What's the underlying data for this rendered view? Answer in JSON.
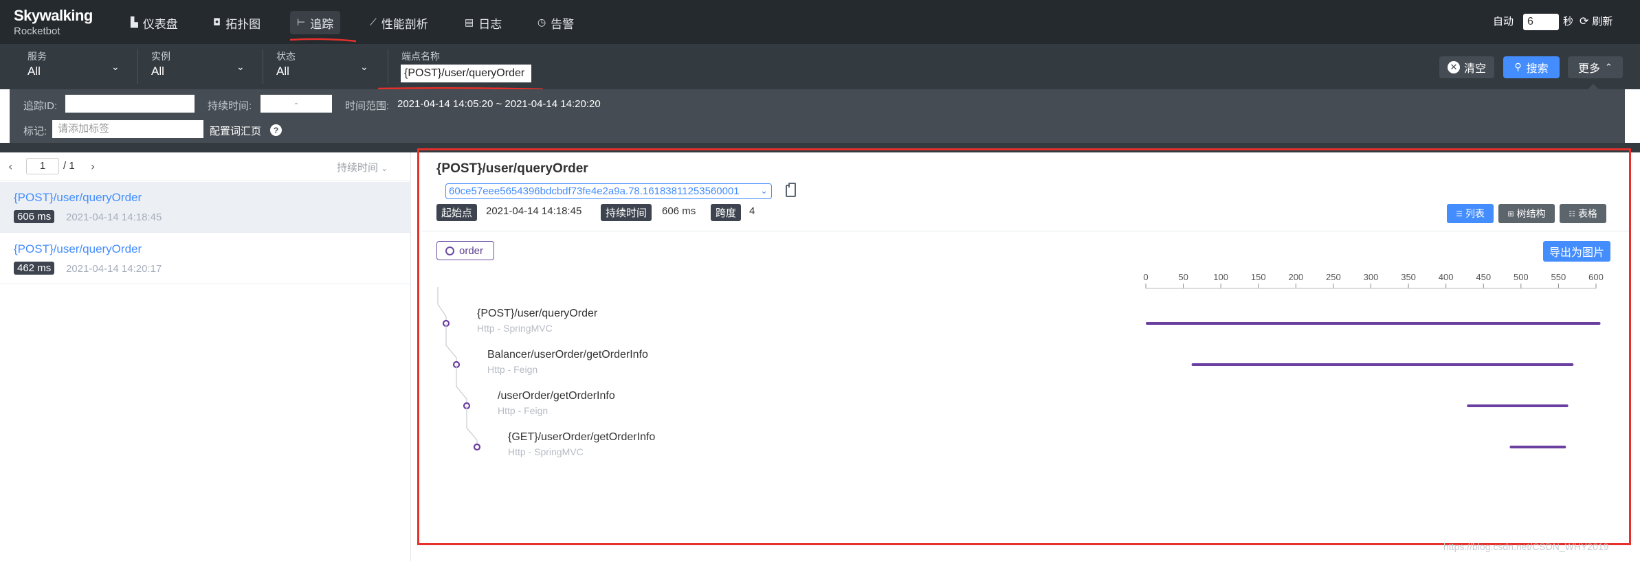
{
  "app": {
    "logo_line1": "Skywalking",
    "logo_line2": "Rocketbot"
  },
  "nav": {
    "items": [
      {
        "label": "仪表盘",
        "icon": "dashboard-icon"
      },
      {
        "label": "拓扑图",
        "icon": "topology-icon"
      },
      {
        "label": "追踪",
        "icon": "trace-icon",
        "active": true
      },
      {
        "label": "性能剖析",
        "icon": "profile-icon"
      },
      {
        "label": "日志",
        "icon": "log-icon"
      },
      {
        "label": "告警",
        "icon": "alarm-icon"
      }
    ],
    "auto_label": "自动",
    "auto_value": "6",
    "seconds_label": "秒",
    "refresh_label": "刷新"
  },
  "filters": {
    "service_label": "服务",
    "service_value": "All",
    "instance_label": "实例",
    "instance_value": "All",
    "status_label": "状态",
    "status_value": "All",
    "endpoint_label": "端点名称",
    "endpoint_value": "{POST}/user/queryOrder",
    "clear_label": "清空",
    "search_label": "搜索",
    "more_label": "更多"
  },
  "ext_filters": {
    "trace_id_label": "追踪ID:",
    "trace_id_value": "",
    "duration_label": "持续时间:",
    "duration_sep": "-",
    "time_range_label": "时间范围:",
    "time_range_value": "2021-04-14 14:05:20 ~ 2021-04-14 14:20:20",
    "tags_label": "标记:",
    "tags_placeholder": "请添加标签",
    "config_link": "配置词汇页",
    "help": "?"
  },
  "trace_list": {
    "page": "1",
    "total": "/ 1",
    "sort_label": "持续时间",
    "items": [
      {
        "name": "{POST}/user/queryOrder",
        "duration": "606 ms",
        "time": "2021-04-14 14:18:45"
      },
      {
        "name": "{POST}/user/queryOrder",
        "duration": "462 ms",
        "time": "2021-04-14 14:20:17"
      }
    ]
  },
  "detail": {
    "title": "{POST}/user/queryOrder",
    "trace_id": "60ce57eee5654396bdcbdf73fe4e2a9a.78.16183811253560001",
    "start_label": "起始点",
    "start_value": "2021-04-14 14:18:45",
    "duration_label": "持续时间",
    "duration_value": "606 ms",
    "span_label": "跨度",
    "span_value": "4",
    "view_list": "列表",
    "view_tree": "树结构",
    "view_table": "表格",
    "service_tag": "order",
    "export_label": "导出为图片",
    "axis": {
      "ticks": [
        "0",
        "50",
        "100",
        "150",
        "200",
        "250",
        "300",
        "350",
        "400",
        "450",
        "500",
        "550",
        "600"
      ],
      "min": 0,
      "max": 600
    },
    "bar_color": "#6b3fa0",
    "spans": [
      {
        "name": "{POST}/user/queryOrder",
        "type": "Http - SpringMVC",
        "depth": 0,
        "start": 0,
        "end": 606
      },
      {
        "name": "Balancer/userOrder/getOrderInfo",
        "type": "Http - Feign",
        "depth": 1,
        "start": 61,
        "end": 570
      },
      {
        "name": "/userOrder/getOrderInfo",
        "type": "Http - Feign",
        "depth": 2,
        "start": 428,
        "end": 563
      },
      {
        "name": "{GET}/userOrder/getOrderInfo",
        "type": "Http - SpringMVC",
        "depth": 3,
        "start": 485,
        "end": 560
      }
    ]
  },
  "watermark": "https://blog.csdn.net/CSDN_WHY2019"
}
